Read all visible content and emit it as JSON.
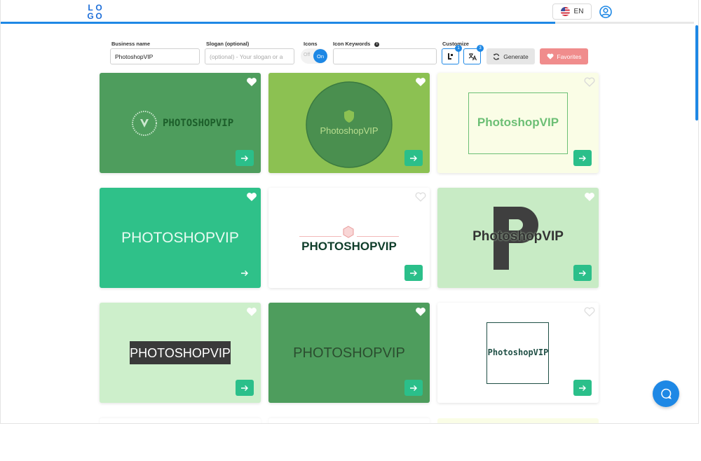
{
  "header": {
    "logo_letters": [
      "L",
      "O",
      "G",
      "O"
    ],
    "language": "EN",
    "progress_fraction": 0.8
  },
  "form": {
    "business_name_label": "Business name",
    "business_name_value": "PhotoshopVIP",
    "slogan_label": "Slogan (optional)",
    "slogan_placeholder": "(optional) - Your slogan or a",
    "icons_label": "Icons",
    "icons_toggle_off": "Off",
    "icons_toggle_on": "On",
    "icon_keywords_label": "Icon Keywords",
    "icon_keywords_value": "",
    "customize_label": "Customize",
    "customize_font_badge": "1",
    "customize_lang_badge": "3",
    "generate_label": "Generate",
    "favorites_label": "Favorites"
  },
  "cards": [
    {
      "logo_text": "PHOTOSHOPVIP",
      "favorited": true,
      "background": "#4e9d5d"
    },
    {
      "logo_text": "PhotoshopVIP",
      "favorited": true,
      "background": "#8cc152"
    },
    {
      "logo_text": "PhotoshopVIP",
      "favorited": false,
      "background": "#fafde6"
    },
    {
      "logo_text": "PHOTOSHOPVIP",
      "favorited": true,
      "background": "#2fc189"
    },
    {
      "logo_text": "PHOTOSHOPVIP",
      "favorited": false,
      "background": "#ffffff"
    },
    {
      "logo_text": "PhotoshopVIP",
      "favorited": false,
      "background": "#c8ebc5"
    },
    {
      "logo_text": "PHOTOSHOPVIP",
      "favorited": false,
      "background": "#cdefcb"
    },
    {
      "logo_text": "PHOTOSHOPVIP",
      "favorited": true,
      "background": "#4e9d5d"
    },
    {
      "logo_text": "PhotoshopVIP",
      "favorited": false,
      "background": "#ffffff"
    }
  ],
  "colors": {
    "accent": "#1e88e5",
    "go_button": "#2bbf8a",
    "favorites_button": "#f08c8c"
  }
}
